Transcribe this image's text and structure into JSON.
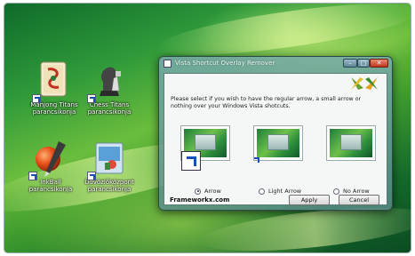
{
  "desktop": {
    "icons": [
      {
        "name": "mahjong",
        "label_line1": "Mahjong Titans",
        "label_line2": "parancsikonja"
      },
      {
        "name": "chess",
        "label_line1": "Chess Titans",
        "label_line2": "parancsikonja"
      },
      {
        "name": "inkball",
        "label_line1": "InkBall",
        "label_line2": "parancsikonja"
      },
      {
        "name": "welcome",
        "label_line1": "Üdvözlőközpont",
        "label_line2": "parancsikonja"
      }
    ]
  },
  "dialog": {
    "title": "Vista Shortcut Overlay Remover",
    "window_buttons": {
      "minimize": "–",
      "maximize": "□",
      "close": "✕"
    },
    "instruction": "Please select if you wish to have the regular arrow, a small arrow or nothing over your Windows Vista shotcuts.",
    "options": [
      {
        "label": "Arrow",
        "selected": true
      },
      {
        "label": "Light Arrow",
        "selected": false
      },
      {
        "label": "No Arrow",
        "selected": false
      }
    ],
    "site": "Frameworkx.com",
    "apply_label": "Apply",
    "cancel_label": "Cancel"
  },
  "colors": {
    "wallpaper_dark": "#0f6a2a",
    "wallpaper_light": "#6bbd3c",
    "close_button": "#c2351e",
    "arrow_blue": "#1a4fb8"
  }
}
